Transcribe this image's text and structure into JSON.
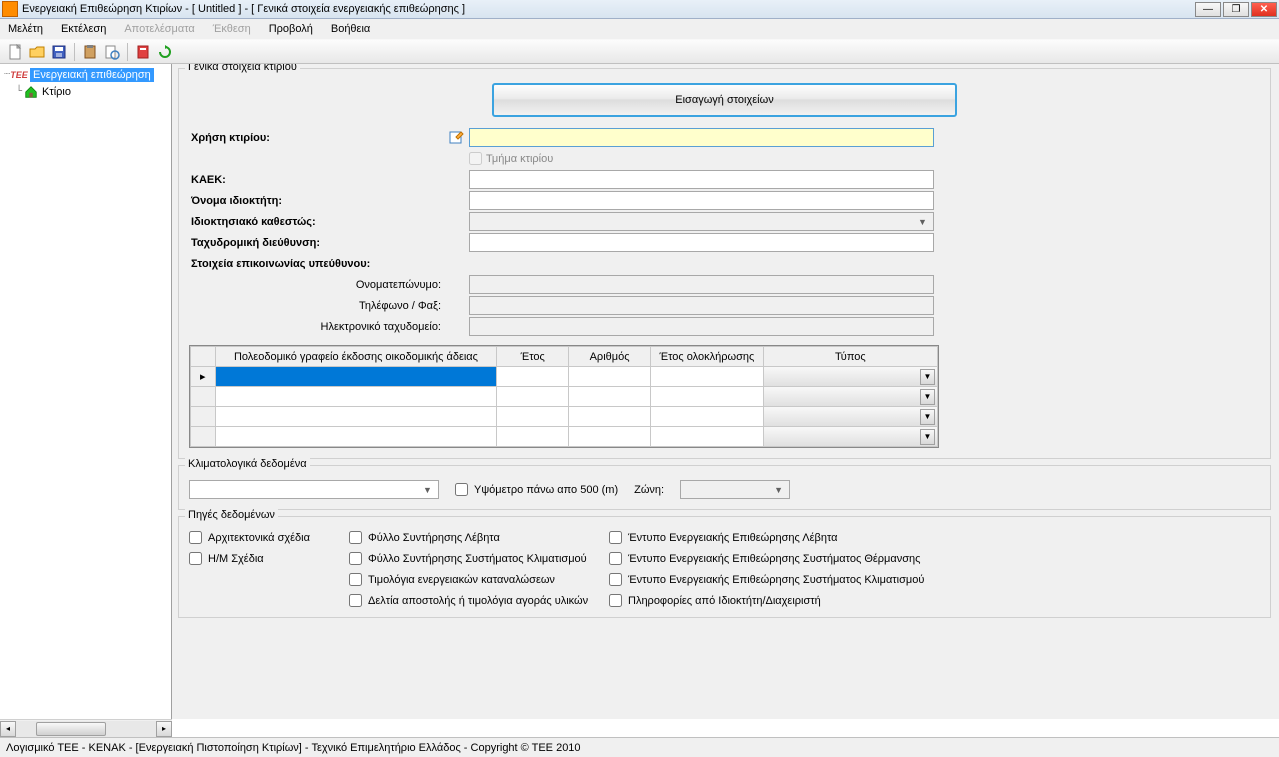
{
  "window": {
    "title": "Ενεργειακή Επιθεώρηση Κτιρίων - [ Untitled ] - [ Γενικά στοιχεία ενεργειακής επιθεώρησης ]"
  },
  "menu": {
    "items": [
      "Μελέτη",
      "Εκτέλεση",
      "Αποτελέσματα",
      "Έκθεση",
      "Προβολή",
      "Βοήθεια"
    ],
    "disabled": [
      2,
      3
    ]
  },
  "tree": {
    "items": [
      {
        "label": "Ενεργειακή επιθεώρηση",
        "selected": true,
        "icon": "tee"
      },
      {
        "label": "Κτίριο",
        "selected": false,
        "icon": "house"
      }
    ]
  },
  "groups": {
    "g1_title": "Γενικά στοιχεία κτιρίου",
    "g2_title": "Κλιματολογικά δεδομένα",
    "g3_title": "Πηγές δεδομένων"
  },
  "form": {
    "import_btn": "Εισαγωγή στοιχείων",
    "use_label": "Χρήση κτιρίου:",
    "use_value": "",
    "section_label": "Τμήμα κτιρίου",
    "kaek_label": "ΚΑΕΚ:",
    "kaek_value": "",
    "owner_label": "Όνομα ιδιοκτήτη:",
    "owner_value": "",
    "ownership_label": "Ιδιοκτησιακό καθεστώς:",
    "ownership_value": "",
    "address_label": "Ταχυδρομική διεύθυνση:",
    "address_value": "",
    "contact_label": "Στοιχεία επικοινωνίας υπεύθυνου:",
    "fullname_label": "Ονοματεπώνυμο:",
    "fullname_value": "",
    "phone_label": "Τηλέφωνο / Φαξ:",
    "phone_value": "",
    "email_label": "Ηλεκτρονικό ταχυδομείο:",
    "email_value": ""
  },
  "grid": {
    "cols": [
      "Πολεοδομικό γραφείο έκδοσης οικοδομικής άδειας",
      "Έτος",
      "Αριθμός",
      "Έτος ολοκλήρωσης",
      "Τύπος"
    ]
  },
  "climate": {
    "altitude_label": "Υψόμετρο πάνω απο 500 (m)",
    "zone_label": "Ζώνη:"
  },
  "sources": {
    "col1": [
      "Αρχιτεκτονικά σχέδια",
      "Η/Μ Σχέδια"
    ],
    "col2": [
      "Φύλλο Συντήρησης Λέβητα",
      "Φύλλο Συντήρησης Συστήματος Κλιματισμού",
      "Τιμολόγια ενεργειακών καταναλώσεων",
      "Δελτία αποστολής ή τιμολόγια αγοράς υλικών"
    ],
    "col3": [
      "Έντυπο Ενεργειακής Επιθεώρησης Λέβητα",
      "Έντυπο Ενεργειακής Επιθεώρησης Συστήματος Θέρμανσης",
      "Έντυπο Ενεργειακής Επιθεώρησης Συστήματος Κλιματισμού",
      "Πληροφορίες από Ιδιοκτήτη/Διαχειριστή"
    ]
  },
  "status": {
    "text": "Λογισμικό ΤΕΕ - ΚΕΝΑΚ  -  [Ενεργειακή Πιστοποίηση Κτιρίων]  -  Τεχνικό Επιμελητήριο Ελλάδος  -  Copyright © TEE 2010"
  }
}
